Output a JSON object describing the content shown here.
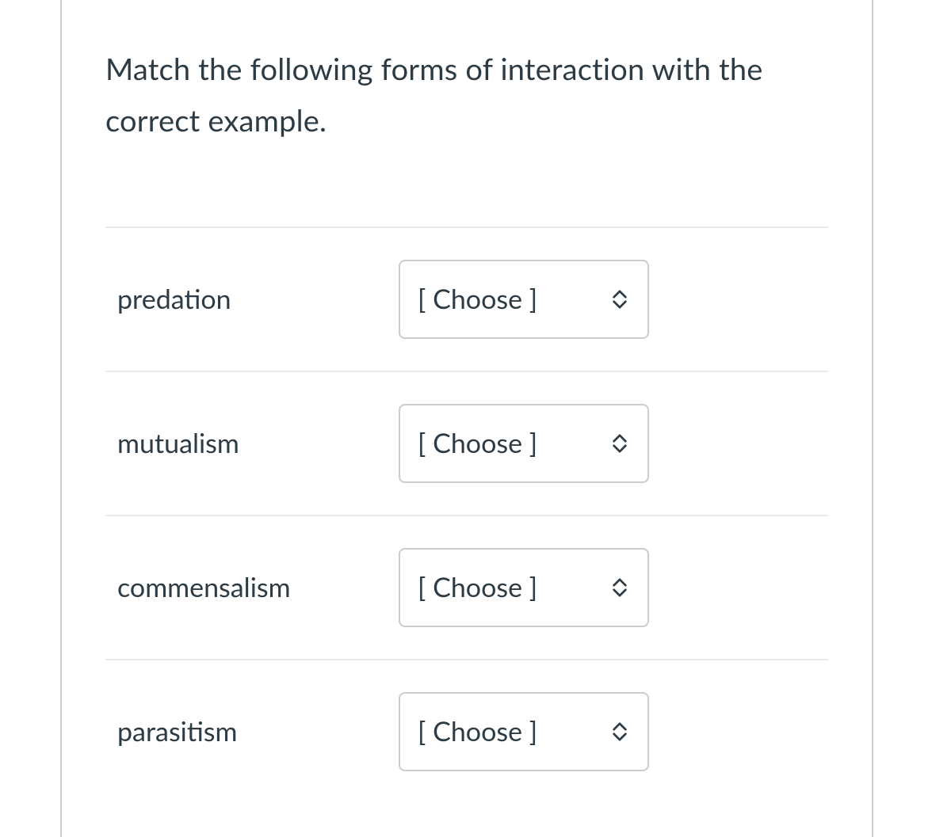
{
  "question": {
    "prompt": "Match the following forms of interaction with the correct example."
  },
  "select_placeholder": "[ Choose ]",
  "items": [
    {
      "label": "predation"
    },
    {
      "label": "mutualism"
    },
    {
      "label": "commensalism"
    },
    {
      "label": "parasitism"
    }
  ]
}
